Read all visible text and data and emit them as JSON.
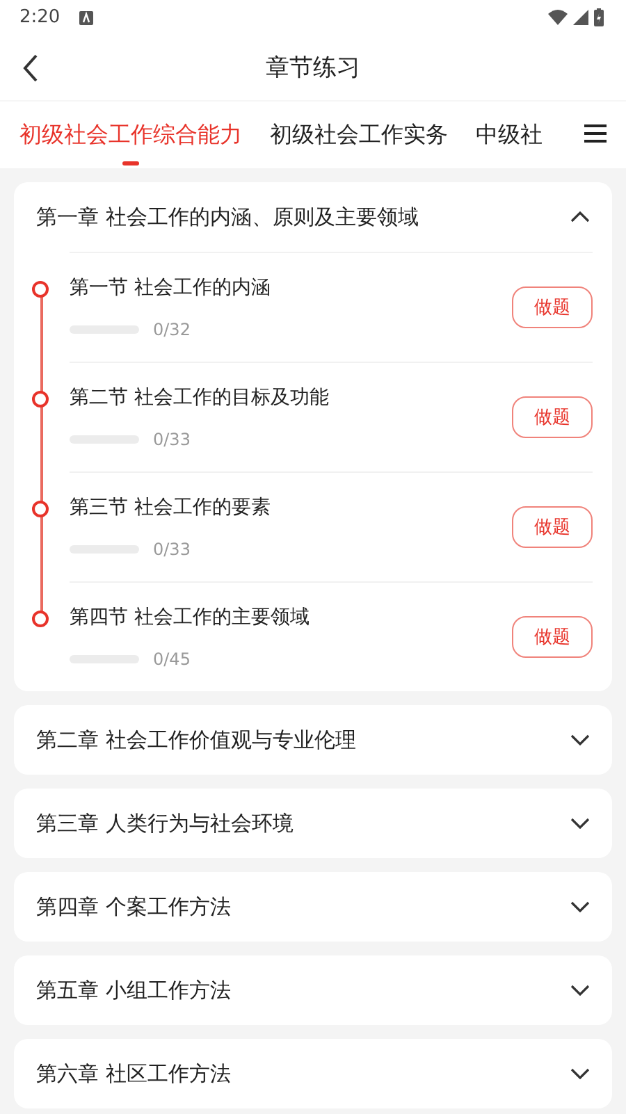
{
  "status_bar": {
    "time": "2:20"
  },
  "header": {
    "title": "章节练习"
  },
  "tabs": [
    {
      "label": "初级社会工作综合能力",
      "selected": true
    },
    {
      "label": "初级社会工作实务",
      "selected": false
    },
    {
      "label": "中级社",
      "selected": false
    }
  ],
  "chapters": [
    {
      "title": "第一章 社会工作的内涵、原则及主要领域",
      "expanded": true,
      "sections": [
        {
          "title": "第一节 社会工作的内涵",
          "level": 0,
          "progress": "0/32",
          "button": "做题"
        },
        {
          "title": "第二节 社会工作的目标及功能",
          "level": 0,
          "progress": "0/33",
          "button": "做题"
        },
        {
          "title": "第三节 社会工作的要素",
          "level": 0,
          "progress": "0/33",
          "button": "做题"
        },
        {
          "title": "第四节 社会工作的主要领域",
          "level": 0,
          "progress": "0/45",
          "button": "做题"
        }
      ]
    },
    {
      "title": "第二章 社会工作价值观与专业伦理",
      "expanded": false
    },
    {
      "title": "第三章 人类行为与社会环境",
      "expanded": false
    },
    {
      "title": "第四章 个案工作方法",
      "expanded": false
    },
    {
      "title": "第五章 小组工作方法",
      "expanded": false
    },
    {
      "title": "第六章 社区工作方法",
      "expanded": false
    }
  ]
}
